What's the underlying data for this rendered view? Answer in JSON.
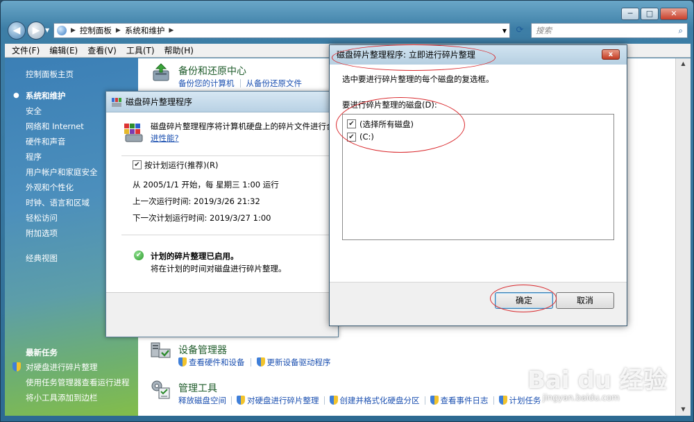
{
  "window": {
    "minimize": "─",
    "maximize": "□",
    "close": "✕"
  },
  "nav": {
    "breadcrumb": [
      "控制面板",
      "系统和维护"
    ],
    "search_placeholder": "搜索"
  },
  "menu": [
    "文件(F)",
    "编辑(E)",
    "查看(V)",
    "工具(T)",
    "帮助(H)"
  ],
  "left_pane": {
    "home": "控制面板主页",
    "current": "系统和维护",
    "items": [
      "安全",
      "网络和 Internet",
      "硬件和声音",
      "程序",
      "用户帐户和家庭安全",
      "外观和个性化",
      "时钟、语言和区域",
      "轻松访问",
      "附加选项"
    ],
    "classic": "经典视图",
    "recent_title": "最新任务",
    "recent_items": [
      "对硬盘进行碎片整理",
      "使用任务管理器查看运行进程",
      "将小工具添加到边栏"
    ]
  },
  "content": {
    "backup": {
      "title": "备份和还原中心",
      "links": [
        "备份您的计算机",
        "从备份还原文件"
      ]
    },
    "device_manager": {
      "title": "设备管理器",
      "links": [
        "查看硬件和设备",
        "更新设备驱动程序"
      ]
    },
    "admin_tools": {
      "title": "管理工具",
      "links": [
        "释放磁盘空间",
        "对硬盘进行碎片整理",
        "创建并格式化硬盘分区",
        "查看事件日志",
        "计划任务"
      ]
    }
  },
  "defrag": {
    "title": "磁盘碎片整理程序",
    "desc": "磁盘碎片整理程序将计算机硬盘上的碎片文件进行合",
    "desc_link": "进性能?",
    "schedule_label": "按计划运行(推荐)(R)",
    "schedule_line": "从 2005/1/1 开始，每 星期三 1:00 运行",
    "last_run": "上一次运行时间: 2019/3/26 21:32",
    "next_run": "下一次计划运行时间: 2019/3/27 1:00",
    "status_title": "计划的碎片整理已启用。",
    "status_desc": "将在计划的时间对磁盘进行碎片整理。"
  },
  "dialog": {
    "title": "磁盘碎片整理程序: 立即进行碎片整理",
    "instruction": "选中要进行碎片整理的每个磁盘的复选框。",
    "disks_label": "要进行碎片整理的磁盘(D):",
    "disks": [
      {
        "label": "(选择所有磁盘)",
        "checked": "✔"
      },
      {
        "label": "(C:)",
        "checked": "✔"
      }
    ],
    "ok": "确定",
    "cancel": "取消",
    "close": "x"
  },
  "watermark": {
    "brand": "Bai du 经验",
    "url": "jingyan.baidu.com"
  },
  "colors": {
    "link": "#1a4fb0",
    "annotation": "#d9262a"
  }
}
